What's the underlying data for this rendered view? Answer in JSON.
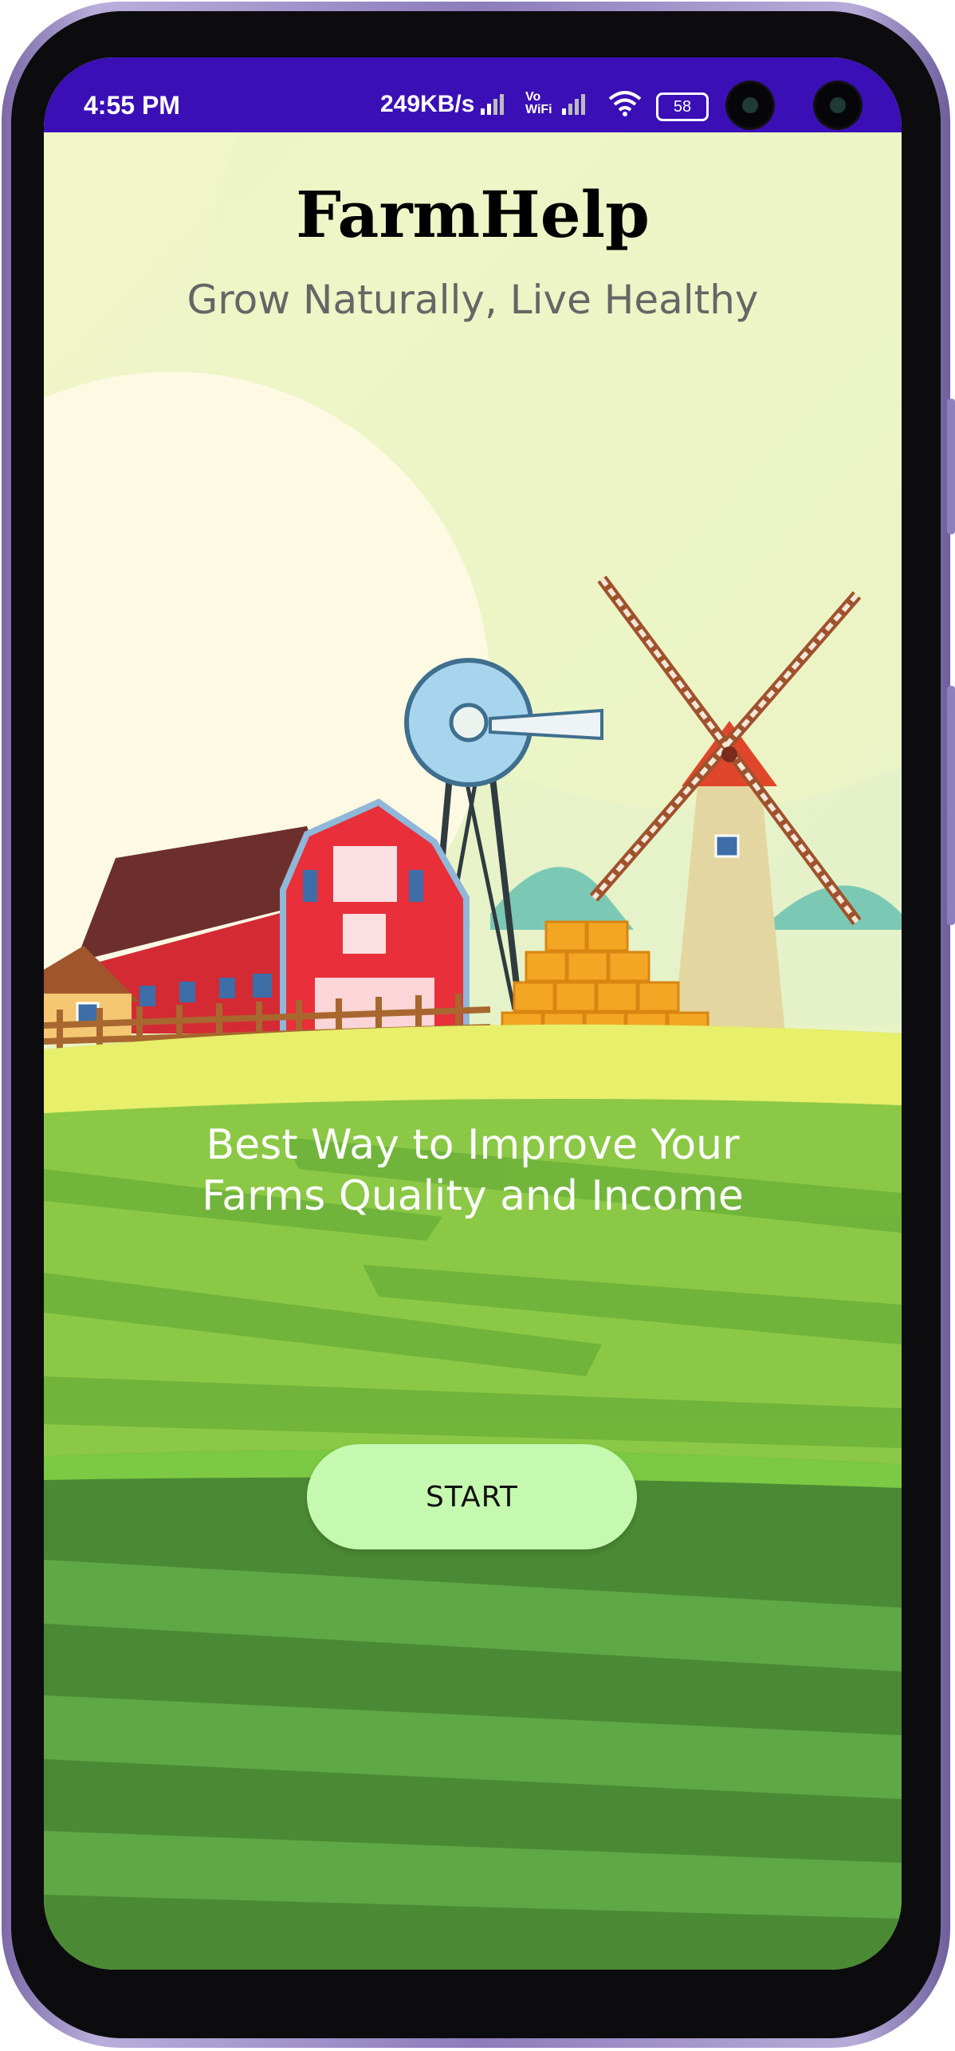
{
  "status_bar": {
    "time": "4:55 PM",
    "network_speed": "249KB/s",
    "volte_label": "Vo",
    "wifi_label": "WiFi",
    "battery": "58",
    "icons": [
      "signal-icon",
      "vowifi-icon",
      "signal-icon",
      "wifi-icon",
      "battery-icon"
    ]
  },
  "app": {
    "title": "FarmHelp",
    "subtitle": "Grow Naturally, Live Healthy",
    "headline_line1": "Best Way to Improve Your",
    "headline_line2": "Farms Quality and Income",
    "start_label": "START"
  },
  "colors": {
    "status_bar": "#3a0fb6",
    "button": "#c6f9b0",
    "field_green": "#5ea845",
    "sky": "#e9f4c6"
  }
}
